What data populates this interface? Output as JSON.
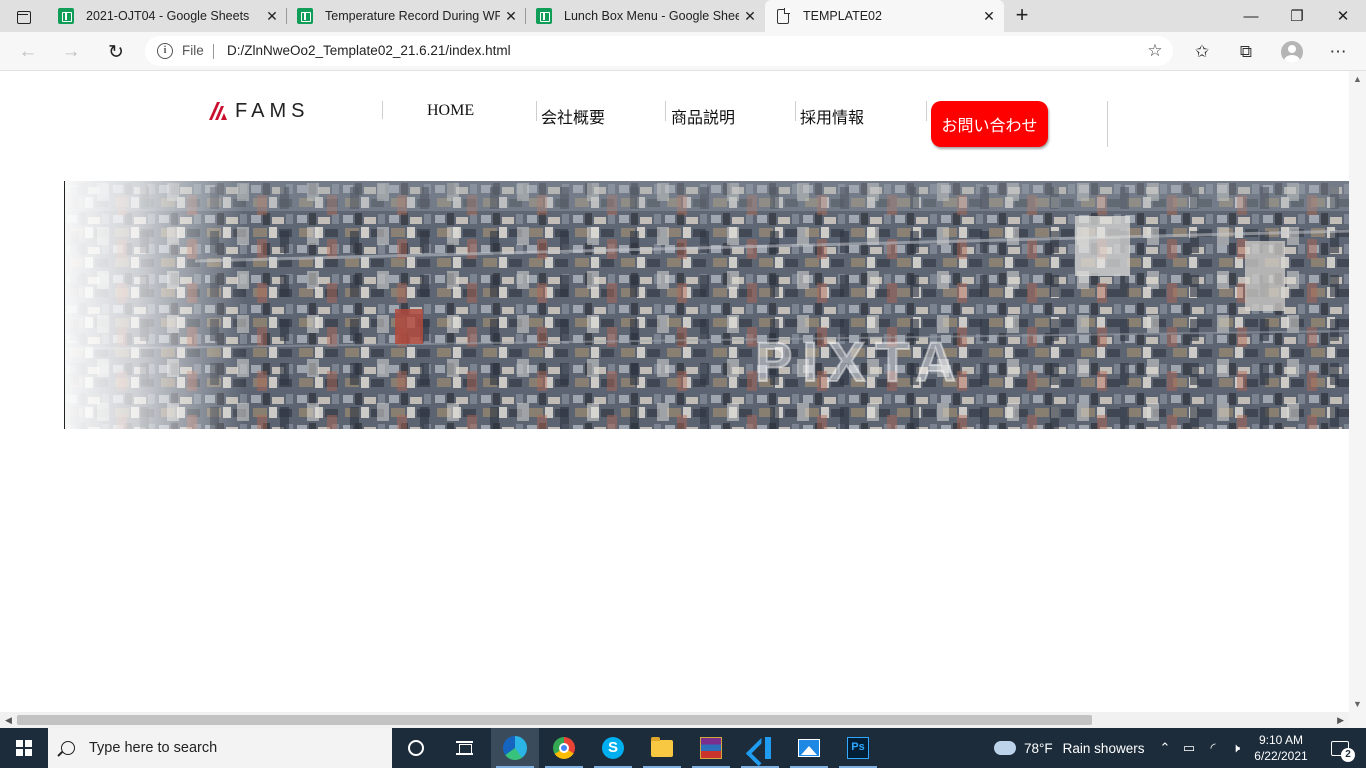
{
  "browser": {
    "tabs": [
      {
        "title": "2021-OJT04 - Google Sheets",
        "icon": "google-sheets-icon"
      },
      {
        "title": "Temperature Record During WFH",
        "icon": "google-sheets-icon"
      },
      {
        "title": "Lunch Box Menu - Google Sheets",
        "icon": "google-sheets-icon"
      },
      {
        "title": "TEMPLATE02",
        "icon": "page-icon",
        "active": true
      }
    ],
    "address": {
      "scheme_label": "File",
      "url": "D:/ZlnNweOo2_Template02_21.6.21/index.html"
    }
  },
  "page": {
    "logo_text": "FAMS",
    "nav": [
      "HOME",
      "会社概要",
      "商品説明",
      "採用情報"
    ],
    "contact_button": "お問い合わせ",
    "hero_watermark": "PIXTA"
  },
  "taskbar": {
    "search_placeholder": "Type here to search",
    "weather": {
      "temp": "78°F",
      "condition": "Rain showers"
    },
    "clock": {
      "time": "9:10 AM",
      "date": "6/22/2021"
    },
    "notification_count": "2"
  },
  "colors": {
    "contact_button": "#ff0000",
    "logo_mark": "#c8102e",
    "taskbar": "#1c2c3b"
  }
}
